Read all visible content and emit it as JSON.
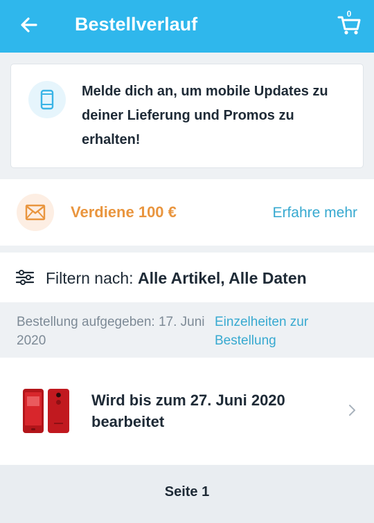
{
  "header": {
    "title": "Bestellverlauf",
    "cart_count": "0",
    "back_icon": "arrow-left-icon",
    "cart_icon": "shopping-cart-icon",
    "background_color": "#2fb7ec"
  },
  "promo_banner": {
    "icon": "mobile-phone-icon",
    "text": "Melde dich an, um mobile Updates zu deiner Lieferung und Promos zu erhalten!"
  },
  "earn_banner": {
    "icon": "envelope-icon",
    "text": "Verdiene 100 €",
    "link": "Erfahre mehr",
    "accent_color": "#e9953e",
    "link_color": "#37a9d0"
  },
  "filter": {
    "icon": "sliders-icon",
    "label": "Filtern nach:",
    "value": "Alle Artikel, Alle Daten"
  },
  "order": {
    "placed_text": "Bestellung aufgegeben: 17. Juni 2020",
    "details_link": "Einzelheiten zur Bestellung",
    "items": [
      {
        "image": "red-smartphone-image",
        "status": "Wird bis zum 27. Juni 2020 bearbeitet"
      }
    ]
  },
  "pagination": {
    "label": "Seite 1"
  }
}
